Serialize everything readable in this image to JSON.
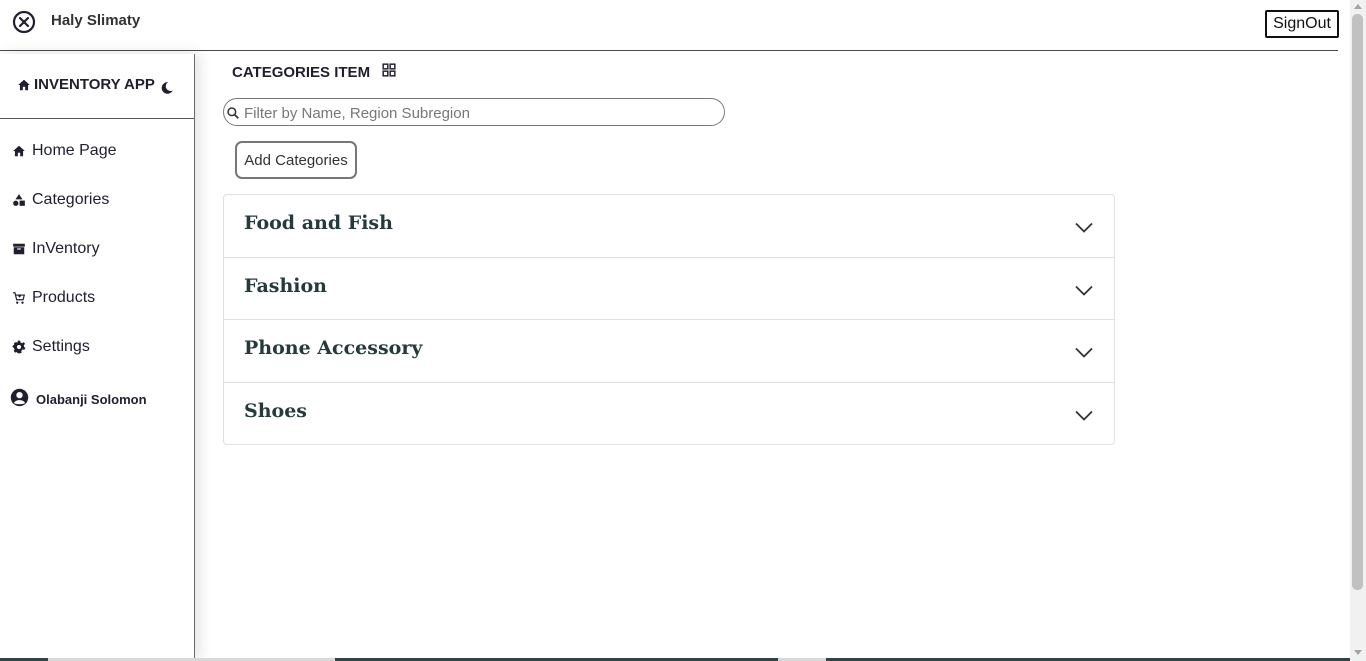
{
  "header": {
    "brand": "Haly Slimaty",
    "signout_label": "SignOut"
  },
  "sidebar": {
    "app_title": "INVENTORY APP",
    "items": [
      {
        "label": "Home Page",
        "icon": "home-icon"
      },
      {
        "label": "Categories",
        "icon": "shapes-icon"
      },
      {
        "label": "InVentory",
        "icon": "archive-icon"
      },
      {
        "label": "Products",
        "icon": "cart-icon"
      },
      {
        "label": "Settings",
        "icon": "gear-icon"
      }
    ],
    "user_name": "Olabanji Solomon"
  },
  "main": {
    "title": "CATEGORIES ITEM",
    "search_placeholder": "Filter by Name, Region Subregion",
    "add_button": "Add Categories",
    "categories": [
      {
        "label": "Food and Fish"
      },
      {
        "label": "Fashion"
      },
      {
        "label": "Phone Accessory"
      },
      {
        "label": "Shoes"
      }
    ]
  }
}
